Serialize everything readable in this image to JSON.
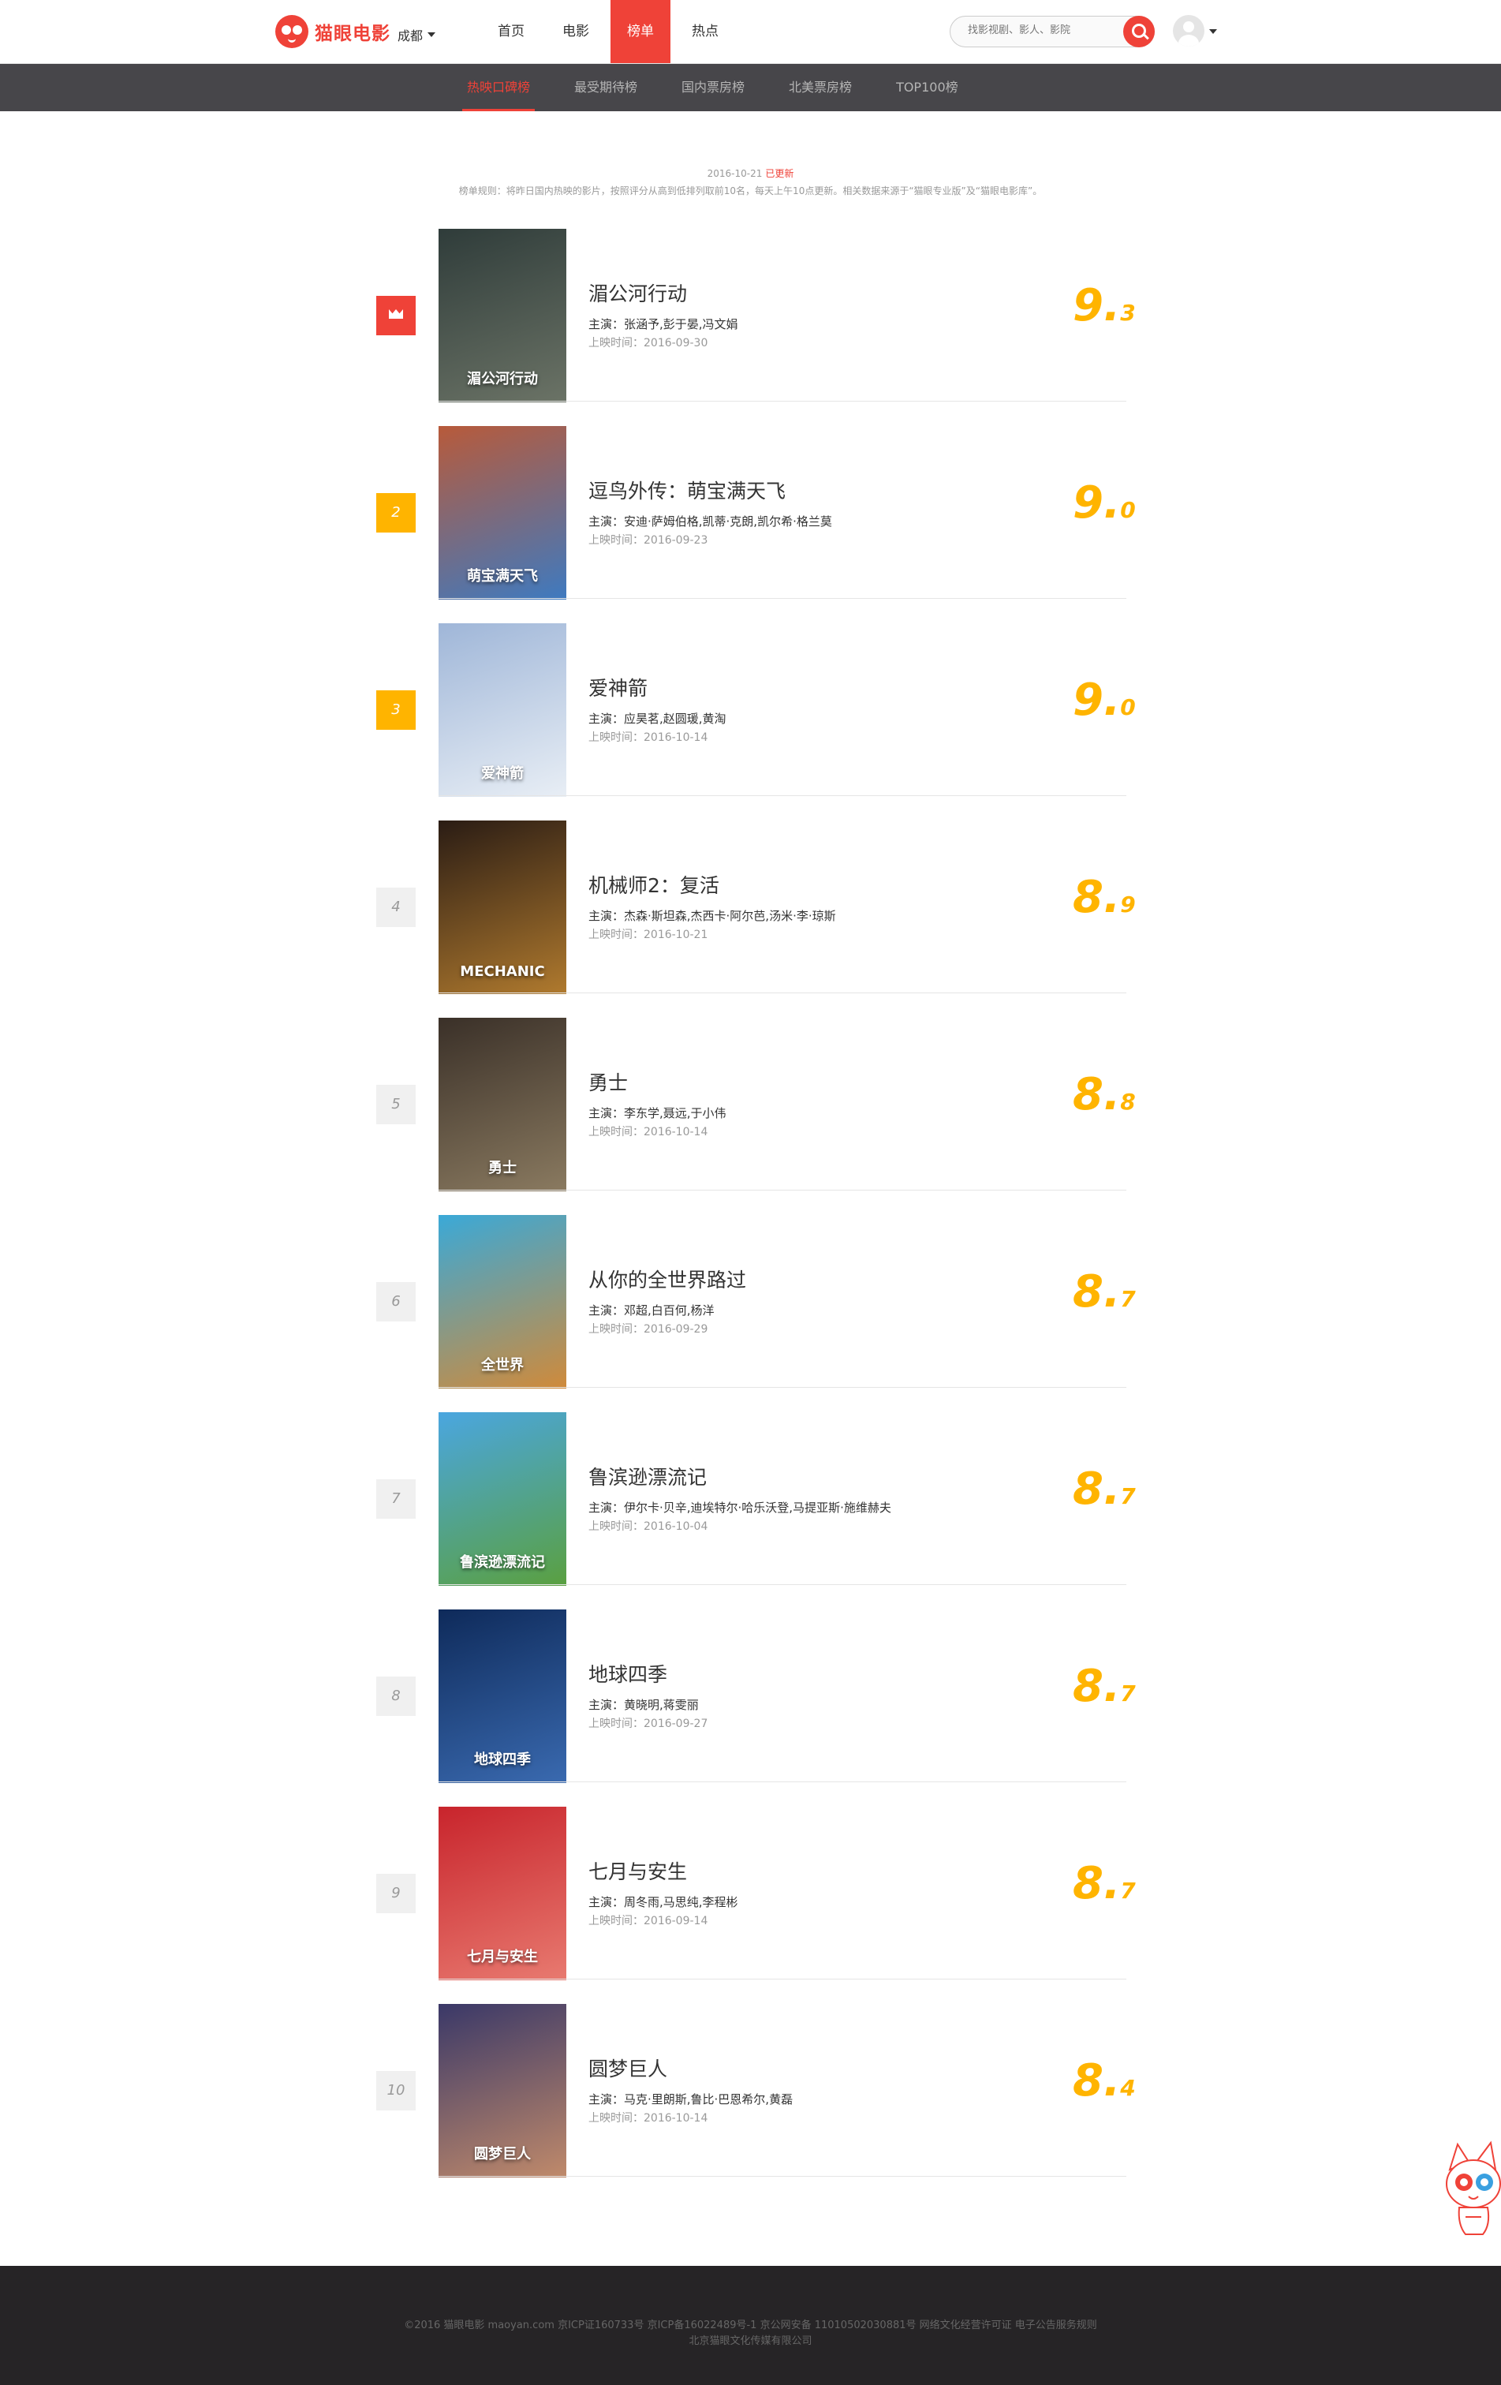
{
  "header": {
    "logo_text": "猫眼电影",
    "city": "成都",
    "nav": [
      {
        "label": "首页",
        "active": false
      },
      {
        "label": "电影",
        "active": false
      },
      {
        "label": "榜单",
        "active": true
      },
      {
        "label": "热点",
        "active": false
      }
    ],
    "search_placeholder": "找影视剧、影人、影院"
  },
  "subnav": [
    {
      "label": "热映口碑榜",
      "active": true
    },
    {
      "label": "最受期待榜",
      "active": false
    },
    {
      "label": "国内票房榜",
      "active": false
    },
    {
      "label": "北美票房榜",
      "active": false
    },
    {
      "label": "TOP100榜",
      "active": false
    }
  ],
  "update": {
    "date": "2016-10-21",
    "status": "已更新",
    "rule": "榜单规则：将昨日国内热映的影片，按照评分从高到低排列取前10名，每天上午10点更新。相关数据来源于“猫眼专业版”及“猫眼电影库”。"
  },
  "movies": [
    {
      "rank": "1",
      "title": "湄公河行动",
      "actors": "主演：张涵予,彭于晏,冯文娟",
      "release": "上映时间：2016-09-30",
      "score_int": "9.",
      "score_frac": "3",
      "poster_text": "湄公河行动",
      "colors": [
        "#2f3c3a",
        "#6b7366"
      ]
    },
    {
      "rank": "2",
      "title": "逗鸟外传：萌宝满天飞",
      "actors": "主演：安迪·萨姆伯格,凯蒂·克朗,凯尔希·格兰莫",
      "release": "上映时间：2016-09-23",
      "score_int": "9.",
      "score_frac": "0",
      "poster_text": "萌宝满天飞",
      "colors": [
        "#b85a3a",
        "#3e7ac0"
      ]
    },
    {
      "rank": "3",
      "title": "爱神箭",
      "actors": "主演：应昊茗,赵圆瑗,黄淘",
      "release": "上映时间：2016-10-14",
      "score_int": "9.",
      "score_frac": "0",
      "poster_text": "爱神箭",
      "colors": [
        "#9fb6d8",
        "#e8eef5"
      ]
    },
    {
      "rank": "4",
      "title": "机械师2：复活",
      "actors": "主演：杰森·斯坦森,杰西卡·阿尔芭,汤米·李·琼斯",
      "release": "上映时间：2016-10-21",
      "score_int": "8.",
      "score_frac": "9",
      "poster_text": "MECHANIC",
      "colors": [
        "#2a1c14",
        "#b07a2e"
      ]
    },
    {
      "rank": "5",
      "title": "勇士",
      "actors": "主演：李东学,聂远,于小伟",
      "release": "上映时间：2016-10-14",
      "score_int": "8.",
      "score_frac": "8",
      "poster_text": "勇士",
      "colors": [
        "#3a3028",
        "#8a7a60"
      ]
    },
    {
      "rank": "6",
      "title": "从你的全世界路过",
      "actors": "主演：邓超,白百何,杨洋",
      "release": "上映时间：2016-09-29",
      "score_int": "8.",
      "score_frac": "7",
      "poster_text": "全世界",
      "colors": [
        "#3aa9d8",
        "#d08a3a"
      ]
    },
    {
      "rank": "7",
      "title": "鲁滨逊漂流记",
      "actors": "主演：伊尔卡·贝辛,迪埃特尔·哈乐沃登,马提亚斯·施维赫夫",
      "release": "上映时间：2016-10-04",
      "score_int": "8.",
      "score_frac": "7",
      "poster_text": "鲁滨逊漂流记",
      "colors": [
        "#4aa6e0",
        "#5aa040"
      ]
    },
    {
      "rank": "8",
      "title": "地球四季",
      "actors": "主演：黄晓明,蒋雯丽",
      "release": "上映时间：2016-09-27",
      "score_int": "8.",
      "score_frac": "7",
      "poster_text": "地球四季",
      "colors": [
        "#0e2a5a",
        "#3a6ab0"
      ]
    },
    {
      "rank": "9",
      "title": "七月与安生",
      "actors": "主演：周冬雨,马思纯,李程彬",
      "release": "上映时间：2016-09-14",
      "score_int": "8.",
      "score_frac": "7",
      "poster_text": "七月与安生",
      "colors": [
        "#c8242c",
        "#e87a70"
      ]
    },
    {
      "rank": "10",
      "title": "圆梦巨人",
      "actors": "主演：马克·里朗斯,鲁比·巴恩希尔,黄磊",
      "release": "上映时间：2016-10-14",
      "score_int": "8.",
      "score_frac": "4",
      "poster_text": "圆梦巨人",
      "colors": [
        "#3a3868",
        "#c08a6a"
      ]
    }
  ],
  "footer": {
    "line1": "©2016 猫眼电影 maoyan.com 京ICP证160733号 京ICP备16022489号-1 京公网安备 11010502030881号 网络文化经营许可证 电子公告服务规则",
    "line2": "北京猫眼文化传媒有限公司"
  },
  "colors": {
    "accent": "#ef4238",
    "score": "#ffb400",
    "subnav_bg": "#47464a",
    "footer_bg": "#262426"
  }
}
